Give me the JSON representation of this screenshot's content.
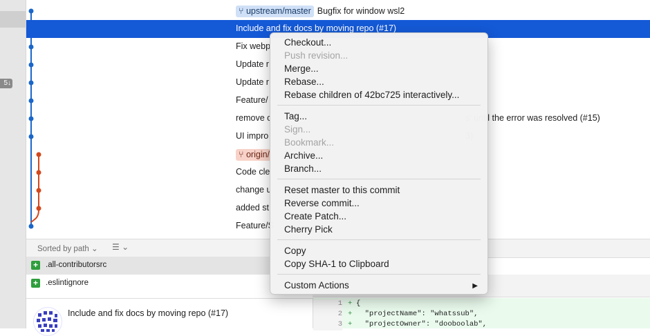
{
  "sidebar": {
    "badge": "5↓"
  },
  "commits": [
    {
      "ref": "upstream/master",
      "ref_kind": "upstream",
      "message": "Bugfix for window wsl2",
      "tail": ""
    },
    {
      "ref": "",
      "ref_kind": "",
      "message": "Include and fix docs by moving repo (#17)",
      "tail": "",
      "selected": true
    },
    {
      "ref": "",
      "ref_kind": "",
      "message": "Fix webp",
      "tail": ""
    },
    {
      "ref": "",
      "ref_kind": "",
      "message": "Update r",
      "tail": ""
    },
    {
      "ref": "",
      "ref_kind": "",
      "message": "Update r",
      "tail": ""
    },
    {
      "ref": "",
      "ref_kind": "",
      "message": "Feature/",
      "tail": ""
    },
    {
      "ref": "",
      "ref_kind": "",
      "message": "remove c",
      "tail": "s' until the error was resolved (#15)"
    },
    {
      "ref": "",
      "ref_kind": "",
      "message": "UI impro",
      "tail": "3)"
    },
    {
      "ref": "origin/",
      "ref_kind": "origin",
      "message": "",
      "tail": ""
    },
    {
      "ref": "",
      "ref_kind": "",
      "message": "Code cle",
      "tail": ""
    },
    {
      "ref": "",
      "ref_kind": "",
      "message": "change u",
      "tail": ""
    },
    {
      "ref": "",
      "ref_kind": "",
      "message": "added st",
      "tail": ""
    },
    {
      "ref": "",
      "ref_kind": "",
      "message": "Feature/S",
      "tail": ""
    }
  ],
  "toolbar": {
    "sort_label": "Sorted by path ⌄",
    "list_label": "☰ ⌄"
  },
  "files": [
    {
      "name": ".all-contributorsrc",
      "status": "+"
    },
    {
      "name": ".eslintignore",
      "status": "+"
    }
  ],
  "commit_info": {
    "title": "Include and fix docs by moving repo (#17)"
  },
  "diff": [
    {
      "line": "1",
      "sign": "+",
      "code": "{"
    },
    {
      "line": "2",
      "sign": "+",
      "code": "  \"projectName\": \"whatssub\","
    },
    {
      "line": "3",
      "sign": "+",
      "code": "  \"projectOwner\": \"dooboolab\","
    }
  ],
  "menu": {
    "checkout": "Checkout...",
    "push_revision": "Push revision...",
    "merge": "Merge...",
    "rebase": "Rebase...",
    "rebase_children": "Rebase children of 42bc725 interactively...",
    "tag": "Tag...",
    "sign": "Sign...",
    "bookmark": "Bookmark...",
    "archive": "Archive...",
    "branch": "Branch...",
    "reset_master": "Reset master to this commit",
    "reverse_commit": "Reverse commit...",
    "create_patch": "Create Patch...",
    "cherry_pick": "Cherry Pick",
    "copy": "Copy",
    "copy_sha": "Copy SHA-1 to Clipboard",
    "custom_actions": "Custom Actions",
    "submenu_arrow": "▶"
  },
  "colors": {
    "selection": "#1459d6",
    "graph_blue": "#1a66c9",
    "graph_orange": "#d2481c",
    "added": "#2f9e3d"
  }
}
